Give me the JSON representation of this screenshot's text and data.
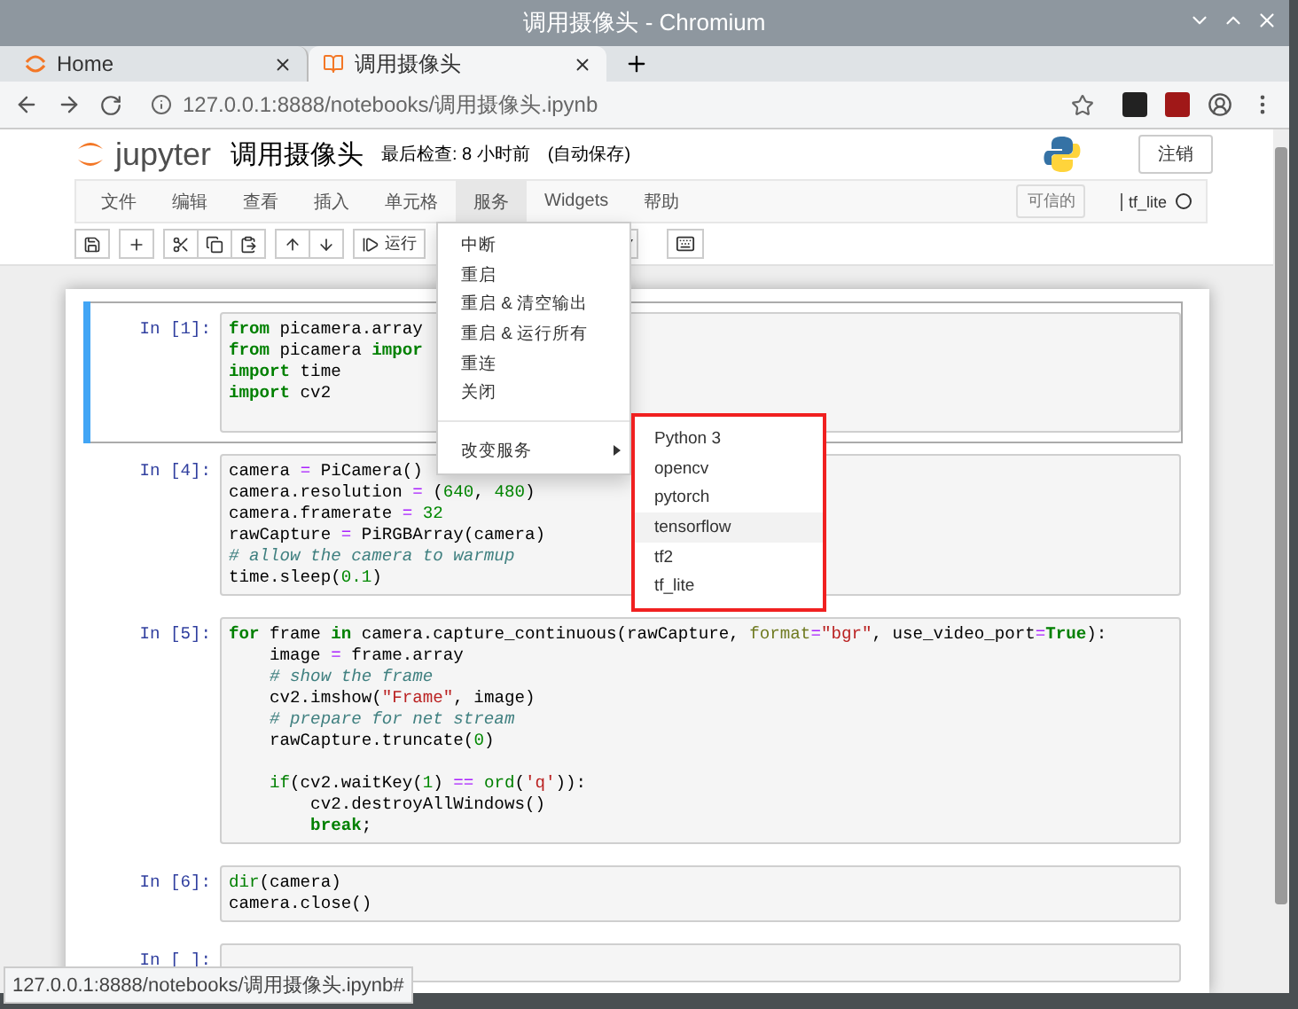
{
  "window": {
    "title": "调用摄像头 - Chromium"
  },
  "tabs": [
    {
      "label": "Home",
      "selected": false
    },
    {
      "label": "调用摄像头",
      "selected": true
    }
  ],
  "address": "127.0.0.1:8888/notebooks/调用摄像头.ipynb",
  "notebook": {
    "logo_text": "jupyter",
    "title": "调用摄像头",
    "checkpoint": "最后检查: 8 小时前",
    "autosave": "(自动保存)",
    "logout": "注销"
  },
  "menubar": [
    {
      "label": "文件",
      "selected": false
    },
    {
      "label": "编辑",
      "selected": false
    },
    {
      "label": "查看",
      "selected": false
    },
    {
      "label": "插入",
      "selected": false
    },
    {
      "label": "单元格",
      "selected": false
    },
    {
      "label": "服务",
      "selected": true
    },
    {
      "label": "Widgets",
      "selected": false
    },
    {
      "label": "帮助",
      "selected": false
    }
  ],
  "trusted": "可信的",
  "kernel": {
    "name": "tf_lite",
    "busy": false
  },
  "toolbar": {
    "run": "运行"
  },
  "service_menu": {
    "items": [
      "中断",
      "重启",
      "重启 & 清空输出",
      "重启 & 运行所有",
      "重连",
      "关闭"
    ],
    "submenu_label": "改变服务",
    "kernels": [
      {
        "label": "Python 3",
        "highlighted": false
      },
      {
        "label": "opencv",
        "highlighted": false
      },
      {
        "label": "pytorch",
        "highlighted": false
      },
      {
        "label": "tensorflow",
        "highlighted": true
      },
      {
        "label": "tf2",
        "highlighted": false
      },
      {
        "label": "tf_lite",
        "highlighted": false
      }
    ]
  },
  "cells": [
    {
      "prompt": "In [1]:",
      "selected": true,
      "trailing_blank": true,
      "lines": [
        {
          "tokens": [
            {
              "kind": "keyword",
              "text": "from"
            },
            {
              "kind": "plain",
              "text": " picamera.array"
            }
          ]
        },
        {
          "tokens": [
            {
              "kind": "keyword",
              "text": "from"
            },
            {
              "kind": "plain",
              "text": " picamera "
            },
            {
              "kind": "keyword",
              "text": "impor"
            }
          ]
        },
        {
          "tokens": [
            {
              "kind": "keyword",
              "text": "import"
            },
            {
              "kind": "plain",
              "text": " time"
            }
          ]
        },
        {
          "tokens": [
            {
              "kind": "keyword",
              "text": "import"
            },
            {
              "kind": "plain",
              "text": " cv2"
            }
          ]
        }
      ]
    },
    {
      "prompt": "In [4]:",
      "selected": false,
      "lines": [
        {
          "tokens": [
            {
              "kind": "plain",
              "text": "camera "
            },
            {
              "kind": "operator",
              "text": "="
            },
            {
              "kind": "plain",
              "text": " PiCamera()"
            }
          ]
        },
        {
          "tokens": [
            {
              "kind": "plain",
              "text": "camera.resolution "
            },
            {
              "kind": "operator",
              "text": "="
            },
            {
              "kind": "plain",
              "text": " ("
            },
            {
              "kind": "number",
              "text": "640"
            },
            {
              "kind": "plain",
              "text": ", "
            },
            {
              "kind": "number",
              "text": "480"
            },
            {
              "kind": "plain",
              "text": ")"
            }
          ]
        },
        {
          "tokens": [
            {
              "kind": "plain",
              "text": "camera.framerate "
            },
            {
              "kind": "operator",
              "text": "="
            },
            {
              "kind": "number",
              "text": " 32"
            }
          ]
        },
        {
          "tokens": [
            {
              "kind": "plain",
              "text": "rawCapture "
            },
            {
              "kind": "operator",
              "text": "="
            },
            {
              "kind": "plain",
              "text": " PiRGBArray(camera)"
            }
          ]
        },
        {
          "tokens": [
            {
              "kind": "comment",
              "text": "# allow the camera to warmup"
            }
          ]
        },
        {
          "tokens": [
            {
              "kind": "plain",
              "text": "time.sleep("
            },
            {
              "kind": "number",
              "text": "0.1"
            },
            {
              "kind": "plain",
              "text": ")"
            }
          ]
        }
      ]
    },
    {
      "prompt": "In [5]:",
      "selected": false,
      "lines": [
        {
          "tokens": [
            {
              "kind": "keyword",
              "text": "for"
            },
            {
              "kind": "plain",
              "text": " frame "
            },
            {
              "kind": "keyword",
              "text": "in"
            },
            {
              "kind": "plain",
              "text": " camera.capture_continuous(rawCapture, "
            },
            {
              "kind": "argument",
              "text": "format"
            },
            {
              "kind": "operator",
              "text": "="
            },
            {
              "kind": "string",
              "text": "\"bgr\""
            },
            {
              "kind": "plain",
              "text": ", use_video_port"
            },
            {
              "kind": "operator",
              "text": "="
            },
            {
              "kind": "keyword",
              "text": "True"
            },
            {
              "kind": "plain",
              "text": "):"
            }
          ]
        },
        {
          "tokens": [
            {
              "kind": "plain",
              "text": "    image "
            },
            {
              "kind": "operator",
              "text": "="
            },
            {
              "kind": "plain",
              "text": " frame.array"
            }
          ]
        },
        {
          "tokens": [
            {
              "kind": "comment",
              "text": "    # show the frame"
            }
          ]
        },
        {
          "tokens": [
            {
              "kind": "plain",
              "text": "    cv2.imshow("
            },
            {
              "kind": "string",
              "text": "\"Frame\""
            },
            {
              "kind": "plain",
              "text": ", image)"
            }
          ]
        },
        {
          "tokens": [
            {
              "kind": "comment",
              "text": "    # prepare for net stream"
            }
          ]
        },
        {
          "tokens": [
            {
              "kind": "plain",
              "text": "    rawCapture.truncate("
            },
            {
              "kind": "number",
              "text": "0"
            },
            {
              "kind": "plain",
              "text": ")"
            }
          ]
        },
        {
          "blank_before": true,
          "tokens": [
            {
              "kind": "builtin",
              "text": "    if"
            },
            {
              "kind": "plain",
              "text": "(cv2.waitKey("
            },
            {
              "kind": "number",
              "text": "1"
            },
            {
              "kind": "plain",
              "text": ") "
            },
            {
              "kind": "operator",
              "text": "=="
            },
            {
              "kind": "builtin",
              "text": " ord"
            },
            {
              "kind": "plain",
              "text": "("
            },
            {
              "kind": "string",
              "text": "'q'"
            },
            {
              "kind": "plain",
              "text": ")):"
            }
          ]
        },
        {
          "tokens": [
            {
              "kind": "plain",
              "text": "        cv2.destroyAllWindows()"
            }
          ]
        },
        {
          "tokens": [
            {
              "kind": "keyword",
              "text": "        break"
            },
            {
              "kind": "plain",
              "text": ";"
            }
          ]
        }
      ]
    },
    {
      "prompt": "In [6]:",
      "selected": false,
      "lines": [
        {
          "tokens": [
            {
              "kind": "builtin",
              "text": "dir"
            },
            {
              "kind": "plain",
              "text": "(camera)"
            }
          ]
        },
        {
          "tokens": [
            {
              "kind": "plain",
              "text": "camera.close()"
            }
          ]
        }
      ]
    },
    {
      "prompt": "In [ ]:",
      "selected": false
    }
  ],
  "status_url": "127.0.0.1:8888/notebooks/调用摄像头.ipynb#"
}
